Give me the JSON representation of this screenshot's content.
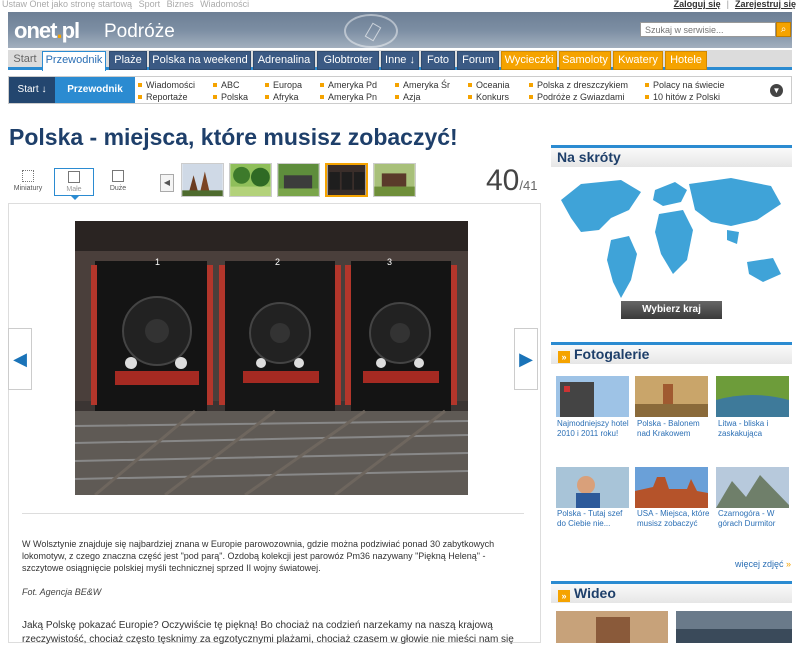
{
  "topbar": {
    "left_items": [
      "Ustaw Onet jako stronę startową",
      "Sport",
      "Biznes",
      "Wiadomości"
    ],
    "login": "Zaloguj się",
    "register": "Zarejestruj się"
  },
  "header": {
    "logo": "onet",
    "logo_dot": ".",
    "logo_tld": "pl",
    "section": "Podróże",
    "search_placeholder": "Szukaj w serwisie..."
  },
  "tabs": [
    {
      "label": "Start",
      "kind": "start"
    },
    {
      "label": "Przewodnik",
      "kind": "active"
    },
    {
      "label": "Plaże",
      "kind": "blue"
    },
    {
      "label": "Polska na weekend",
      "kind": "blue"
    },
    {
      "label": "Adrenalina",
      "kind": "blue"
    },
    {
      "label": "Globtroter",
      "kind": "blue"
    },
    {
      "label": "Inne ↓",
      "kind": "blue"
    },
    {
      "label": "Foto",
      "kind": "blue"
    },
    {
      "label": "Forum",
      "kind": "blue"
    },
    {
      "label": "Wycieczki",
      "kind": "orange"
    },
    {
      "label": "Samoloty",
      "kind": "orange"
    },
    {
      "label": "Kwatery",
      "kind": "orange"
    },
    {
      "label": "Hotele",
      "kind": "orange"
    }
  ],
  "subnav": {
    "start": "Start ↓",
    "active": "Przewodnik",
    "links": [
      "Wiadomości",
      "Reportaże",
      "ABC",
      "Polska",
      "Europa",
      "Afryka",
      "Ameryka Pd",
      "Ameryka Pn",
      "Ameryka Śr",
      "Azja",
      "Oceania",
      "Konkurs",
      "Polska z dreszczykiem",
      "Podróże z Gwiazdami",
      "Polacy na świecie",
      "10 hitów z Polski"
    ]
  },
  "page_title": "Polska - miejsca, które musisz zobaczyć!",
  "view_modes": [
    "Miniatury",
    "Małe",
    "Duże"
  ],
  "counter": {
    "current": "40",
    "total": "/41"
  },
  "article": {
    "text": "W Wolsztynie znajduje się najbardziej znana w Europie parowozownia, gdzie można podziwiać ponad 30 zabytkowych lokomotyw, z czego znaczna część jest \"pod parą\". Ozdobą kolekcji jest parowóz Pm36 nazywany \"Piękną Heleną\" - szczytowe osiągnięcie polskiej myśli technicznej sprzed II wojny światowej.",
    "credit": "Fot. Agencja BE&W",
    "text2": "Jaką Polskę pokazać Europie? Oczywiście tę piękną! Bo chociaż na codzień narzekamy na naszą krajową rzeczywistość, chociaż często tęsknimy za egzotycznymi plażami, chociaż czasem w głowie nie mieści nam się"
  },
  "shed_numbers": [
    "1",
    "2",
    "3"
  ],
  "sidebar": {
    "map_title": "Na skróty",
    "map_button": "Wybierz kraj",
    "gallery_title": "Fotogalerie",
    "gallery": [
      "Najmodniejszy hotel 2010 i 2011 roku!",
      "Polska - Balonem nad Krakowem",
      "Litwa - bliska i zaskakująca",
      "Polska - Tutaj szef do Ciebie nie...",
      "USA - Miejsca, które musisz zobaczyć",
      "Czarnogóra - W górach Durmitor"
    ],
    "more": "więcej zdjęć",
    "video_title": "Wideo"
  },
  "colors": {
    "brand_blue": "#2b8bd1",
    "nav_blue": "#3b5a84",
    "orange": "#f5a300",
    "title_blue": "#1e3f6a"
  }
}
